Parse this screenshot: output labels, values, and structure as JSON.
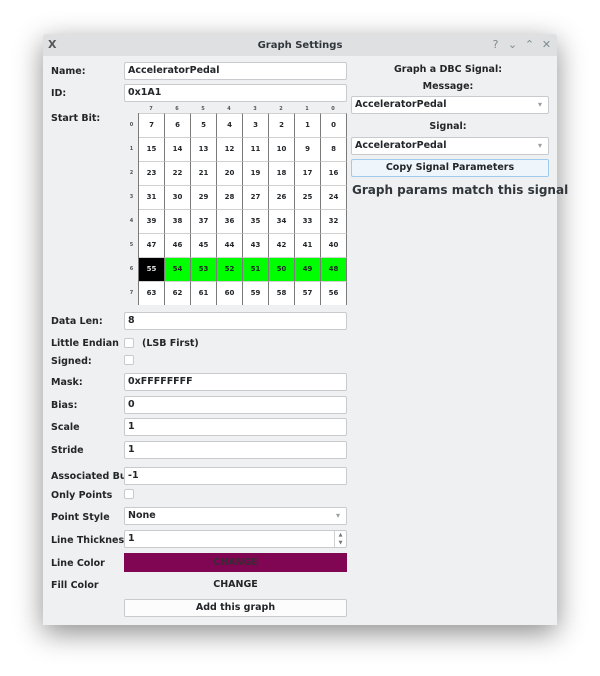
{
  "window": {
    "title": "Graph Settings",
    "controls": [
      "?",
      "⌄",
      "⌃",
      "✕"
    ]
  },
  "form": {
    "name": {
      "label": "Name:",
      "value": "AcceleratorPedal"
    },
    "id": {
      "label": "ID:",
      "value": "0x1A1"
    },
    "start_bit": {
      "label": "Start Bit:",
      "col_headers": [
        "7",
        "6",
        "5",
        "4",
        "3",
        "2",
        "1",
        "0"
      ],
      "row_headers": [
        "0",
        "1",
        "2",
        "3",
        "4",
        "5",
        "6",
        "7"
      ],
      "rows": [
        [
          "7",
          "6",
          "5",
          "4",
          "3",
          "2",
          "1",
          "0"
        ],
        [
          "15",
          "14",
          "13",
          "12",
          "11",
          "10",
          "9",
          "8"
        ],
        [
          "23",
          "22",
          "21",
          "20",
          "19",
          "18",
          "17",
          "16"
        ],
        [
          "31",
          "30",
          "29",
          "28",
          "27",
          "26",
          "25",
          "24"
        ],
        [
          "39",
          "38",
          "37",
          "36",
          "35",
          "34",
          "33",
          "32"
        ],
        [
          "47",
          "46",
          "45",
          "44",
          "43",
          "42",
          "41",
          "40"
        ],
        [
          "55",
          "54",
          "53",
          "52",
          "51",
          "50",
          "49",
          "48"
        ],
        [
          "63",
          "62",
          "61",
          "60",
          "59",
          "58",
          "57",
          "56"
        ]
      ],
      "start_bit_value": "55",
      "selected_bits": [
        "54",
        "53",
        "52",
        "51",
        "50",
        "49",
        "48"
      ],
      "start_color": "#000000",
      "selected_color": "#00ff00"
    },
    "data_len": {
      "label": "Data Len:",
      "value": "8"
    },
    "little_endian": {
      "label": "Little Endian",
      "suffix": "(LSB First)",
      "checked": false
    },
    "signed": {
      "label": "Signed:",
      "checked": false
    },
    "mask": {
      "label": "Mask:",
      "value": "0xFFFFFFFF"
    },
    "bias": {
      "label": "Bias:",
      "value": "0"
    },
    "scale": {
      "label": "Scale",
      "value": "1"
    },
    "stride": {
      "label": "Stride",
      "value": "1"
    },
    "associated_bus": {
      "label": "Associated Bus",
      "value": "-1"
    },
    "only_points": {
      "label": "Only Points",
      "checked": false
    },
    "point_style": {
      "label": "Point Style",
      "value": "None"
    },
    "line_thickness": {
      "label": "Line Thickness",
      "value": "1"
    },
    "line_color": {
      "label": "Line Color",
      "button": "CHANGE",
      "color": "#800552"
    },
    "fill_color": {
      "label": "Fill Color",
      "button": "CHANGE"
    },
    "add_button": "Add this graph"
  },
  "dbc": {
    "title": "Graph a DBC Signal:",
    "message_label": "Message:",
    "message_value": "AcceleratorPedal",
    "signal_label": "Signal:",
    "signal_value": "AcceleratorPedal",
    "copy_button": "Copy Signal Parameters",
    "status": "Graph params match this signal"
  }
}
